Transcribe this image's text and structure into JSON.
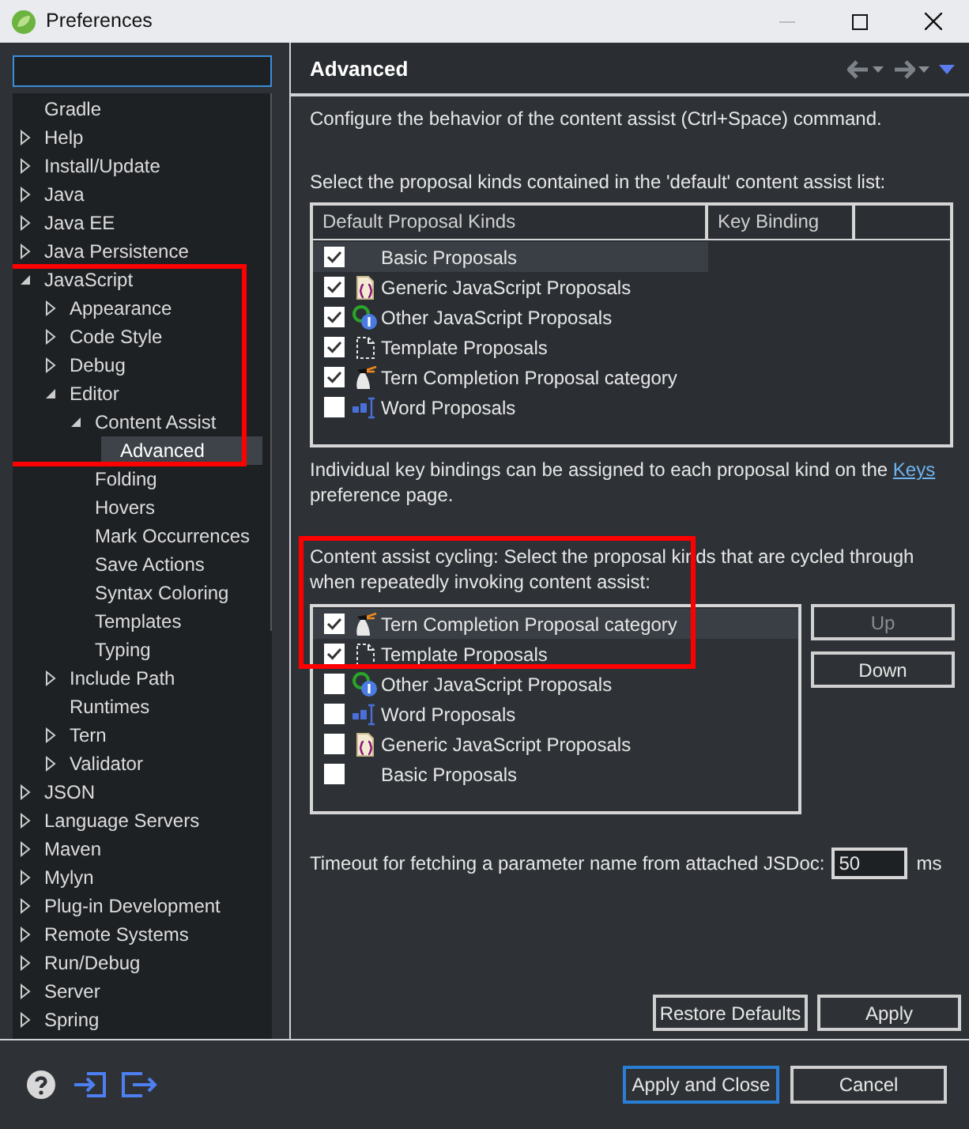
{
  "window": {
    "title": "Preferences"
  },
  "tree_highlighted": true,
  "tree": [
    {
      "label": "Gradle"
    },
    {
      "label": "Help",
      "expanded": false
    },
    {
      "label": "Install/Update",
      "expanded": false
    },
    {
      "label": "Java",
      "expanded": false
    },
    {
      "label": "Java EE",
      "expanded": false
    },
    {
      "label": "Java Persistence",
      "expanded": false
    },
    {
      "label": "JavaScript",
      "expanded": true,
      "children": [
        {
          "label": "Appearance",
          "expanded": false
        },
        {
          "label": "Code Style",
          "expanded": false
        },
        {
          "label": "Debug",
          "expanded": false
        },
        {
          "label": "Editor",
          "expanded": true,
          "children": [
            {
              "label": "Content Assist",
              "expanded": true,
              "children": [
                {
                  "label": "Advanced",
                  "selected": true
                }
              ]
            },
            {
              "label": "Folding",
              "selected": false
            },
            {
              "label": "Hovers",
              "selected": false
            },
            {
              "label": "Mark Occurrences",
              "selected": false
            },
            {
              "label": "Save Actions",
              "selected": false
            },
            {
              "label": "Syntax Coloring",
              "selected": false
            },
            {
              "label": "Templates",
              "selected": false
            },
            {
              "label": "Typing",
              "selected": false
            }
          ]
        },
        {
          "label": "Include Path",
          "expanded": false
        },
        {
          "label": "Runtimes"
        },
        {
          "label": "Tern",
          "expanded": false
        },
        {
          "label": "Validator",
          "expanded": false
        }
      ]
    },
    {
      "label": "JSON",
      "expanded": false
    },
    {
      "label": "Language Servers",
      "expanded": false
    },
    {
      "label": "Maven",
      "expanded": false
    },
    {
      "label": "Mylyn",
      "expanded": false
    },
    {
      "label": "Plug-in Development",
      "expanded": false
    },
    {
      "label": "Remote Systems",
      "expanded": false
    },
    {
      "label": "Run/Debug",
      "expanded": false
    },
    {
      "label": "Server",
      "expanded": false
    },
    {
      "label": "Spring",
      "expanded": false
    }
  ],
  "page": {
    "title": "Advanced",
    "intro": "Configure the behavior of the content assist (Ctrl+Space) command.",
    "default_list_label": "Select the proposal kinds contained in the 'default' content assist list:",
    "default_table": {
      "columns": [
        "Default Proposal Kinds",
        "Key Binding"
      ],
      "rows": [
        {
          "kind": "basic",
          "label": "Basic Proposals",
          "checked": true,
          "selected": true
        },
        {
          "kind": "generic",
          "label": "Generic JavaScript Proposals",
          "checked": true,
          "selected": false
        },
        {
          "kind": "other",
          "label": "Other JavaScript Proposals",
          "checked": true,
          "selected": false
        },
        {
          "kind": "template",
          "label": "Template Proposals",
          "checked": true,
          "selected": false
        },
        {
          "kind": "tern",
          "label": "Tern Completion Proposal category",
          "checked": true,
          "selected": false
        },
        {
          "kind": "word",
          "label": "Word Proposals",
          "checked": false,
          "selected": false
        }
      ]
    },
    "keys_note": {
      "text": "Individual key bindings can be assigned to each proposal kind on the",
      "link": "Keys",
      "after": "preference page."
    },
    "cycling_highlighted": true,
    "cycling_label": "Content assist cycling: Select the proposal kinds that are cycled through when repeatedly invoking content assist:",
    "cycling_list": [
      {
        "kind": "tern",
        "label": "Tern Completion Proposal category",
        "checked": true,
        "selected": true
      },
      {
        "kind": "template",
        "label": "Template Proposals",
        "checked": true,
        "selected": false
      },
      {
        "kind": "other",
        "label": "Other JavaScript Proposals",
        "checked": false,
        "selected": false
      },
      {
        "kind": "word",
        "label": "Word Proposals",
        "checked": false,
        "selected": false
      },
      {
        "kind": "generic",
        "label": "Generic JavaScript Proposals",
        "checked": false,
        "selected": false
      },
      {
        "kind": "basic",
        "label": "Basic Proposals",
        "checked": false,
        "selected": false
      }
    ],
    "order_buttons": [
      {
        "label": "Up",
        "disabled": true
      },
      {
        "label": "Down",
        "disabled": false
      }
    ],
    "timeout": {
      "label": "Timeout for fetching a parameter name from attached JSDoc:",
      "value": "50",
      "unit": "ms"
    },
    "page_buttons": [
      "Restore Defaults",
      "Apply"
    ]
  },
  "dialog_buttons": [
    {
      "label": "Apply and Close",
      "default": true
    },
    {
      "label": "Cancel",
      "default": false
    }
  ]
}
